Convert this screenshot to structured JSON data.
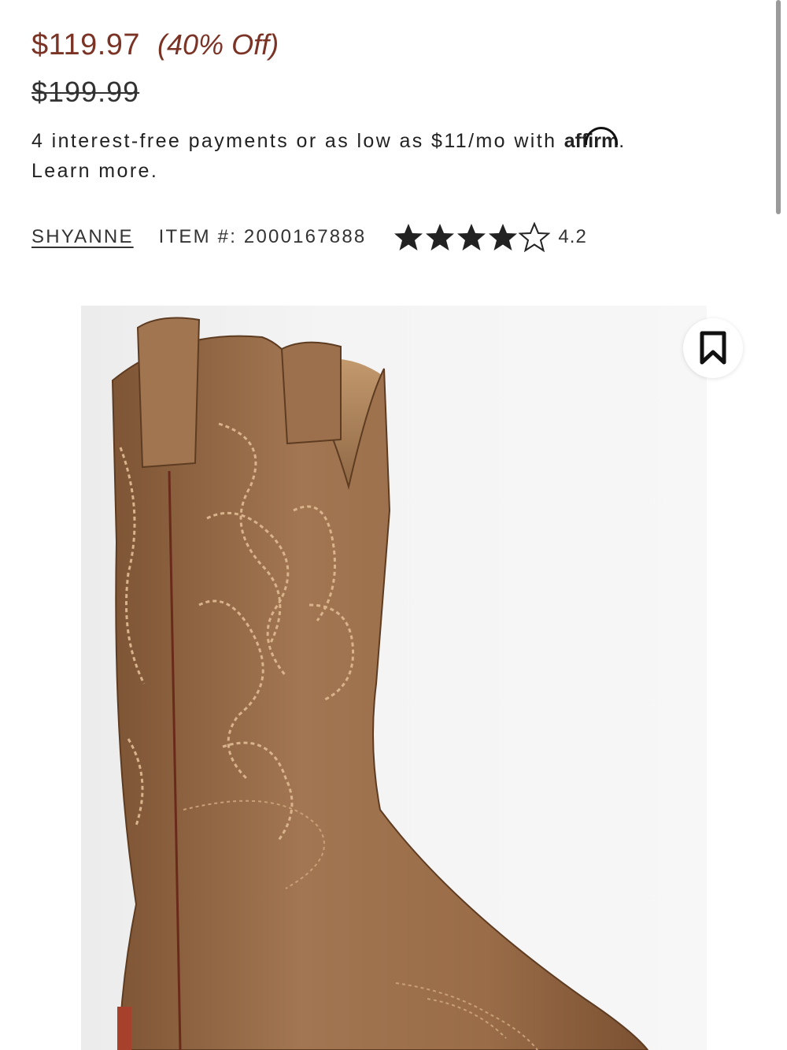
{
  "pricing": {
    "sale_price": "$119.97",
    "discount": "(40% Off)",
    "original_price": "$199.99"
  },
  "financing": {
    "text": "4 interest-free payments or as low as $11/mo with ",
    "logo_text": "affirm",
    "period": ".",
    "learn_more": "Learn more."
  },
  "product_meta": {
    "brand": "SHYANNE",
    "item_number": "ITEM #: 2000167888",
    "rating_value": "4.2",
    "rating": 4.2,
    "rating_max": 5
  },
  "image": {
    "alt_subject": "brown leather western boot",
    "bookmark_icon": "bookmark-icon"
  },
  "colors": {
    "price": "#7a3324",
    "boot": "#9a6b46"
  }
}
